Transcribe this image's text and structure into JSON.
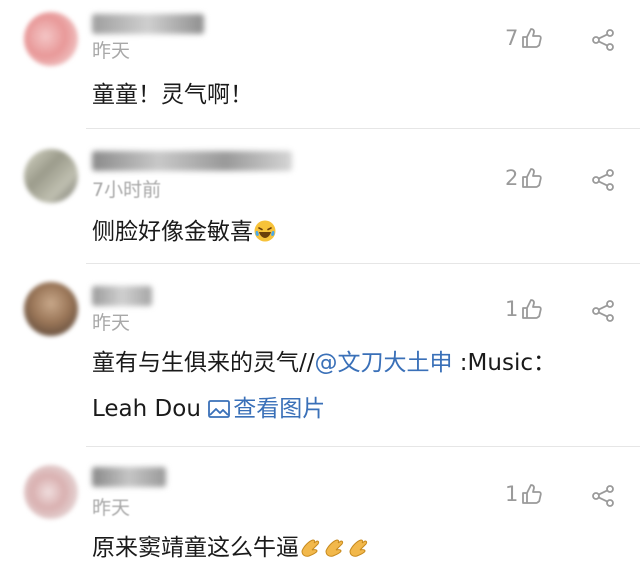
{
  "comments": [
    {
      "time": "昨天",
      "likes": "7",
      "text": "童童！灵气啊！"
    },
    {
      "time": "7小时前",
      "likes": "2",
      "text": "侧脸好像金敏喜",
      "emoji": "laughing-crying-icon"
    },
    {
      "time": "昨天",
      "likes": "1",
      "text_before": "童有与生俱来的灵气//",
      "mention": "@文刀大土申",
      "text_after": " :Music：",
      "text_line2": "Leah Dou ",
      "view_image_label": "查看图片"
    },
    {
      "time": "昨天",
      "likes": "1",
      "text": "原来窦靖童这么牛逼",
      "emoji": "clapping-hands-icon"
    }
  ],
  "colors": {
    "link": "#3a70b8",
    "meta": "#a8a8a8",
    "divider": "#e6e6e6"
  }
}
